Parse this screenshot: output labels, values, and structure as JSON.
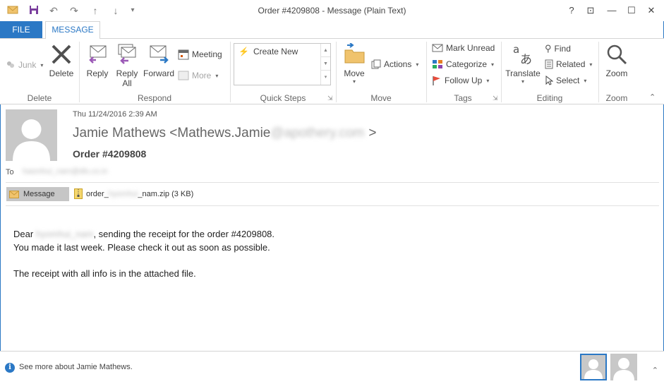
{
  "window": {
    "title": "Order #4209808 - Message (Plain Text)",
    "help": "?",
    "restore": "⊡",
    "minimize": "—",
    "maximize": "☐",
    "close": "✕"
  },
  "tabs": {
    "file": "FILE",
    "message": "MESSAGE"
  },
  "ribbon": {
    "delete_group": {
      "junk": "Junk",
      "delete": "Delete",
      "label": "Delete"
    },
    "respond_group": {
      "reply": "Reply",
      "reply_all_1": "Reply",
      "reply_all_2": "All",
      "forward": "Forward",
      "meeting": "Meeting",
      "more": "More",
      "label": "Respond"
    },
    "quick_steps": {
      "create_new": "Create New",
      "label": "Quick Steps"
    },
    "move_group": {
      "move": "Move",
      "actions": "Actions",
      "label": "Move"
    },
    "tags_group": {
      "mark_unread": "Mark Unread",
      "categorize": "Categorize",
      "follow_up": "Follow Up",
      "label": "Tags"
    },
    "editing_group": {
      "translate": "Translate",
      "find": "Find",
      "related": "Related",
      "select": "Select",
      "label": "Editing"
    },
    "zoom_group": {
      "zoom": "Zoom",
      "label": "Zoom"
    }
  },
  "message": {
    "date": "Thu 11/24/2016 2:39 AM",
    "sender_name": "Jamie Mathews <Mathews.Jamie",
    "sender_domain_blurred": "@apothery.com",
    "sender_end": ">",
    "subject": "Order #4209808",
    "to_label": "To",
    "to_blurred": "hasmhui_nam@dls.co.in",
    "attachment_message": "Message",
    "attachment_file_prefix": "order_",
    "attachment_file_blurred": "hyomhui",
    "attachment_file_suffix": "_nam.zip",
    "attachment_size": "(3 KB)",
    "body": {
      "dear": "Dear ",
      "name_blurred": "hyomhui_nam",
      "line1_rest": ", sending the receipt for the order #4209808.",
      "line2": "You made it last week. Please check it out as soon as possible.",
      "line3": "The receipt with all info is in the attached file."
    }
  },
  "people_pane": {
    "see_more": "See more about Jamie Mathews."
  },
  "colors": {
    "accent": "#2b78c5"
  }
}
